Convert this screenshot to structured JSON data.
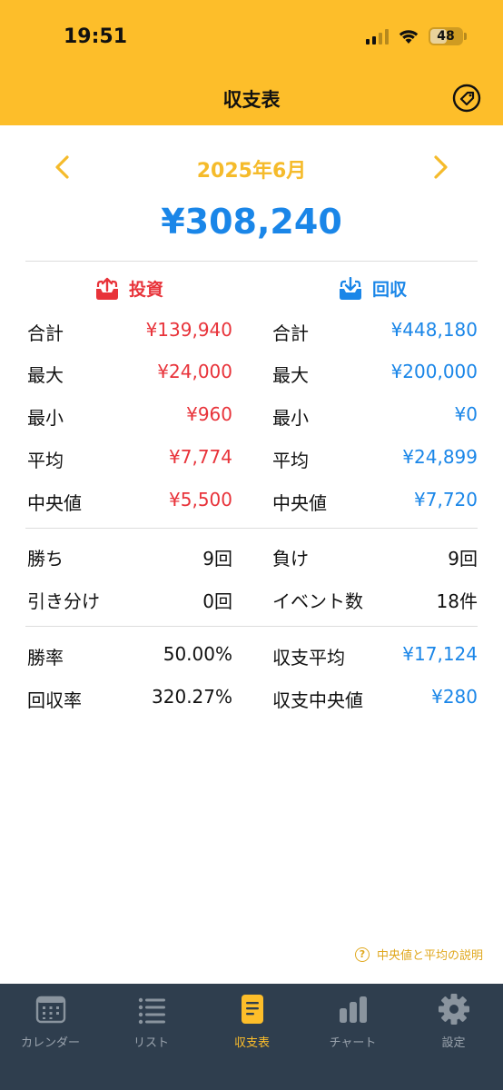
{
  "status": {
    "time": "19:51",
    "battery": "48"
  },
  "nav": {
    "title": "収支表"
  },
  "month": {
    "label": "2025年6月"
  },
  "total": "¥308,240",
  "invest": {
    "title": "投資",
    "rows": [
      {
        "label": "合計",
        "value": "¥139,940"
      },
      {
        "label": "最大",
        "value": "¥24,000"
      },
      {
        "label": "最小",
        "value": "¥960"
      },
      {
        "label": "平均",
        "value": "¥7,774"
      },
      {
        "label": "中央値",
        "value": "¥5,500"
      }
    ]
  },
  "collect": {
    "title": "回収",
    "rows": [
      {
        "label": "合計",
        "value": "¥448,180"
      },
      {
        "label": "最大",
        "value": "¥200,000"
      },
      {
        "label": "最小",
        "value": "¥0"
      },
      {
        "label": "平均",
        "value": "¥24,899"
      },
      {
        "label": "中央値",
        "value": "¥7,720"
      }
    ]
  },
  "results": {
    "wins_label": "勝ち",
    "wins_value": "9回",
    "losses_label": "負け",
    "losses_value": "9回",
    "draws_label": "引き分け",
    "draws_value": "0回",
    "events_label": "イベント数",
    "events_value": "18件"
  },
  "rates": {
    "winrate_label": "勝率",
    "winrate_value": "50.00%",
    "avg_label": "収支平均",
    "avg_value": "¥17,124",
    "return_label": "回収率",
    "return_value": "320.27%",
    "median_label": "収支中央値",
    "median_value": "¥280"
  },
  "help_text": "中央値と平均の説明",
  "tabs": [
    {
      "label": "カレンダー",
      "icon": "calendar-icon"
    },
    {
      "label": "リスト",
      "icon": "list-icon"
    },
    {
      "label": "収支表",
      "icon": "document-icon",
      "active": true
    },
    {
      "label": "チャート",
      "icon": "bar-chart-icon"
    },
    {
      "label": "設定",
      "icon": "gear-icon"
    }
  ],
  "colors": {
    "accent": "#FDBE2A",
    "invest": "#E8333A",
    "collect": "#1A86E8",
    "tabbar": "#2F3E4E"
  }
}
